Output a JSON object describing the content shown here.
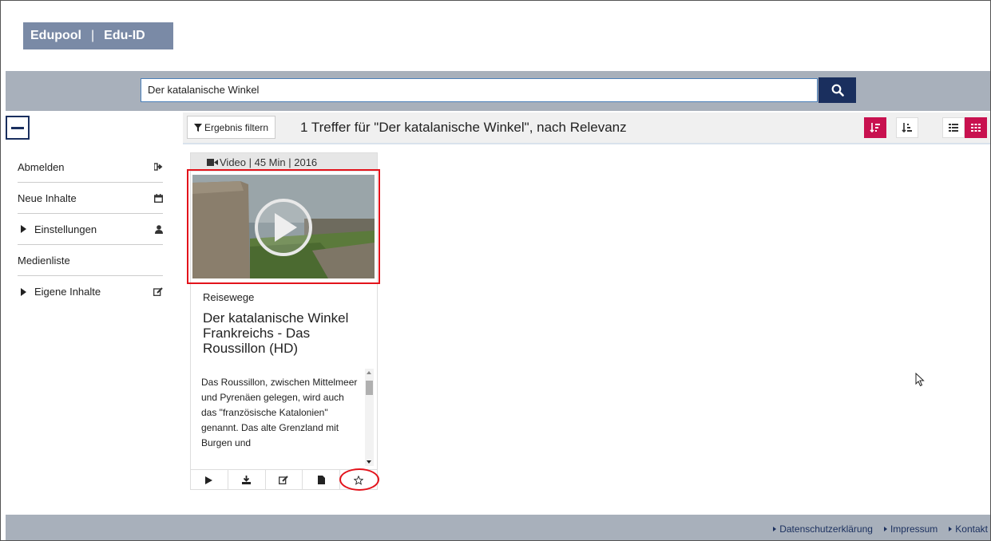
{
  "brand": {
    "left": "Edupool",
    "right": "Edu-ID"
  },
  "search": {
    "value": "Der katalanische Winkel"
  },
  "toolbar": {
    "filter_label": "Ergebnis filtern",
    "results_text": "1 Treffer für \"Der katalanische Winkel\", nach Relevanz"
  },
  "sidebar": {
    "items": [
      {
        "label": "Abmelden",
        "icon": "sign-out-icon"
      },
      {
        "label": "Neue Inhalte",
        "icon": "calendar-icon"
      },
      {
        "label": "Einstellungen",
        "icon": "user-icon"
      },
      {
        "label": "Medienliste",
        "icon": ""
      },
      {
        "label": "Eigene Inhalte",
        "icon": "edit-icon"
      }
    ]
  },
  "card": {
    "meta": "Video | 45 Min | 2016",
    "series": "Reisewege",
    "title": "Der katalanische Winkel Frankreichs - Das Roussillon (HD)",
    "description": "Das Roussillon, zwischen Mittelmeer und Pyrenäen gelegen, wird auch das \"französische Katalonien\" genannt. Das alte Grenzland mit Burgen und"
  },
  "footer": {
    "links": [
      "Datenschutzerklärung",
      "Impressum",
      "Kontakt"
    ]
  },
  "colors": {
    "accent": "#c8114f",
    "navy": "#1a2f5e",
    "highlight": "#e3131b",
    "bar": "#a8b0bb"
  }
}
